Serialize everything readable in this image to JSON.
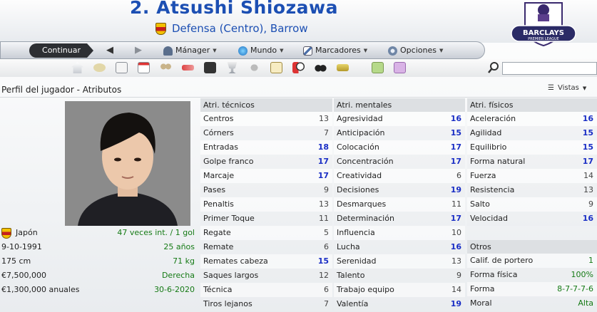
{
  "header": {
    "player_title": "2. Atsushi Shiozawa",
    "subtitle": "Defensa (Centro), Barrow",
    "league_logo_text": "BARCLAYS",
    "league_logo_sub": "PREMIER LEAGUE"
  },
  "menu": {
    "continue_label": "Continuar",
    "items": [
      {
        "label": "Mánager",
        "icon": "manager-icon"
      },
      {
        "label": "Mundo",
        "icon": "globe-icon"
      },
      {
        "label": "Marcadores",
        "icon": "scores-icon"
      },
      {
        "label": "Opciones",
        "icon": "options-icon"
      }
    ]
  },
  "screen": {
    "title": "Perfil del jugador - Atributos",
    "views_label": "Vistas"
  },
  "player_info": [
    {
      "label": "Japón",
      "value": "47 veces int. / 1 gol",
      "flag": true
    },
    {
      "label": "9-10-1991",
      "value": "25 años"
    },
    {
      "label": "175 cm",
      "value": "71 kg"
    },
    {
      "label": "€7,500,000",
      "value": "Derecha"
    },
    {
      "label": "€1,300,000 anuales",
      "value": "30-6-2020"
    }
  ],
  "tecnicos": {
    "title": "Atri. técnicos",
    "rows": [
      {
        "name": "Centros",
        "value": "13",
        "hi": false
      },
      {
        "name": "Córners",
        "value": "7",
        "hi": false
      },
      {
        "name": "Entradas",
        "value": "18",
        "hi": true
      },
      {
        "name": "Golpe franco",
        "value": "17",
        "hi": true
      },
      {
        "name": "Marcaje",
        "value": "17",
        "hi": true
      },
      {
        "name": "Pases",
        "value": "9",
        "hi": false
      },
      {
        "name": "Penaltis",
        "value": "13",
        "hi": false
      },
      {
        "name": "Primer Toque",
        "value": "11",
        "hi": false
      },
      {
        "name": "Regate",
        "value": "5",
        "hi": false
      },
      {
        "name": "Remate",
        "value": "6",
        "hi": false
      },
      {
        "name": "Remates cabeza",
        "value": "15",
        "hi": true
      },
      {
        "name": "Saques largos",
        "value": "12",
        "hi": false
      },
      {
        "name": "Técnica",
        "value": "6",
        "hi": false
      },
      {
        "name": "Tiros lejanos",
        "value": "7",
        "hi": false
      }
    ]
  },
  "mentales": {
    "title": "Atri. mentales",
    "rows": [
      {
        "name": "Agresividad",
        "value": "16",
        "hi": true
      },
      {
        "name": "Anticipación",
        "value": "15",
        "hi": true
      },
      {
        "name": "Colocación",
        "value": "17",
        "hi": true
      },
      {
        "name": "Concentración",
        "value": "17",
        "hi": true
      },
      {
        "name": "Creatividad",
        "value": "6",
        "hi": false
      },
      {
        "name": "Decisiones",
        "value": "19",
        "hi": true
      },
      {
        "name": "Desmarques",
        "value": "11",
        "hi": false
      },
      {
        "name": "Determinación",
        "value": "17",
        "hi": true
      },
      {
        "name": "Influencia",
        "value": "10",
        "hi": false
      },
      {
        "name": "Lucha",
        "value": "16",
        "hi": true
      },
      {
        "name": "Serenidad",
        "value": "13",
        "hi": false
      },
      {
        "name": "Talento",
        "value": "9",
        "hi": false
      },
      {
        "name": "Trabajo equipo",
        "value": "14",
        "hi": false
      },
      {
        "name": "Valentía",
        "value": "19",
        "hi": true
      }
    ]
  },
  "fisicos": {
    "title": "Atri. físicos",
    "rows": [
      {
        "name": "Aceleración",
        "value": "16",
        "hi": true
      },
      {
        "name": "Agilidad",
        "value": "15",
        "hi": true
      },
      {
        "name": "Equilibrio",
        "value": "15",
        "hi": true
      },
      {
        "name": "Forma natural",
        "value": "17",
        "hi": true
      },
      {
        "name": "Fuerza",
        "value": "14",
        "hi": false
      },
      {
        "name": "Resistencia",
        "value": "13",
        "hi": false
      },
      {
        "name": "Salto",
        "value": "9",
        "hi": false
      },
      {
        "name": "Velocidad",
        "value": "16",
        "hi": true
      }
    ]
  },
  "otros": {
    "title": "Otros",
    "rows": [
      {
        "name": "Calif. de portero",
        "value": "1"
      },
      {
        "name": "Forma física",
        "value": "100%"
      },
      {
        "name": "Forma",
        "value": "8-7-7-7-6"
      },
      {
        "name": "Moral",
        "value": "Alta"
      }
    ]
  },
  "colors": {
    "accent_blue": "#1c4fb3",
    "high_value": "#1a2ec5",
    "green_value": "#157a15"
  }
}
